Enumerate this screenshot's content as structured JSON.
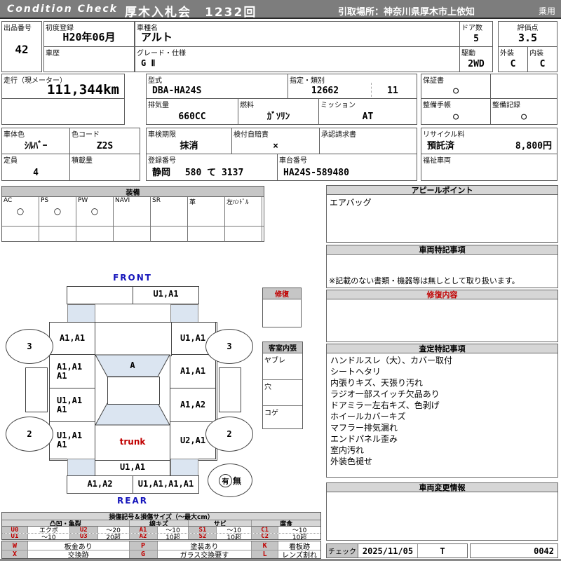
{
  "header": {
    "brand": "Condition  Check",
    "title": "厚木入札会　1232回",
    "pickup": "引取場所：神奈川県厚木市上依知",
    "category": "乗用"
  },
  "info": {
    "lot_label": "出品番号",
    "lot_value": "42",
    "first_reg_label": "初度登録",
    "first_reg_value": "H20年06月",
    "history_label": "車歴",
    "history_value": "",
    "model_label": "車種名",
    "model_value": "アルト",
    "grade_label": "グレード・仕様",
    "grade_value": "G Ⅱ",
    "doors_label": "ドア数",
    "doors_value": "5",
    "drive_label": "駆動",
    "drive_value": "2WD",
    "score_label": "評価点",
    "score_value": "3.5",
    "exterior_label": "外装",
    "exterior_value": "C",
    "interior_label": "内装",
    "interior_value": "C",
    "mileage_label": "走行（現メーター）",
    "mileage_value": "111,344km",
    "type_label": "型式",
    "type_value": "DBA-HA24S",
    "class_label": "指定・類別",
    "class_value1": "12662",
    "class_value2": "11",
    "displacement_label": "排気量",
    "displacement_value": "660CC",
    "fuel_label": "燃料",
    "fuel_value": "ｶﾞｿﾘﾝ",
    "transmission_label": "ミッション",
    "transmission_value": "AT",
    "warranty_label": "保証書",
    "warranty_value": "○",
    "maintenance_book_label": "整備手帳",
    "maintenance_book_value": "○",
    "maintenance_record_label": "整備記録",
    "maintenance_record_value": "○",
    "body_color_label": "車体色",
    "body_color_value": "ｼﾙﾊﾞｰ",
    "color_code_label": "色コード",
    "color_code_value": "Z2S",
    "inspection_label": "車検期限",
    "inspection_value": "抹消",
    "insurance_label": "検付自賠責",
    "insurance_value": "×",
    "approval_label": "承認請求書",
    "approval_value": "",
    "capacity_label": "定員",
    "capacity_value": "4",
    "load_label": "積載量",
    "load_value": "",
    "plate_label": "登録番号",
    "plate_value": "静岡　 580 て  3137",
    "chassis_label": "車台番号",
    "chassis_value": "HA24S-589480",
    "recycle_label": "リサイクル料",
    "recycle_status": "預託済",
    "recycle_fee": "8,800円",
    "welfare_label": "福祉車両",
    "welfare_value": ""
  },
  "equipment": {
    "title": "装備",
    "items": [
      {
        "label": "AC",
        "value": "○"
      },
      {
        "label": "PS",
        "value": "○"
      },
      {
        "label": "PW",
        "value": "○"
      },
      {
        "label": "NAVI",
        "value": ""
      },
      {
        "label": "SR",
        "value": ""
      },
      {
        "label": "革",
        "value": ""
      },
      {
        "label": "左ﾊﾝﾄﾞﾙ",
        "value": ""
      }
    ]
  },
  "diagram": {
    "front": "FRONT",
    "rear": "REAR",
    "front_bumper": "U1,A1",
    "lf_fender": "A1,A1",
    "rf_fender": "U1,A1",
    "lf_door": "A1,A1\nA1",
    "rf_door": "A1,A1",
    "lr_door": "U1,A1\nA1",
    "rr_door": "A1,A2",
    "lr_quarter": "U1,A1\nA1",
    "rr_quarter": "U2,A1",
    "windshield": "A",
    "trunk": "trunk",
    "rear_panel": "U1,A1",
    "rear_bumper_left": "A1,A2",
    "rear_bumper_right": "U1,A1,A1,A1",
    "front_wheel_left": "3",
    "front_wheel_right": "3",
    "rear_wheel_left": "2",
    "rear_wheel_right": "2",
    "presence_yes": "有",
    "presence_no": "無",
    "repair_title": "修復",
    "cabin_title": "客室内張",
    "cabin_rows": [
      "ヤブレ",
      "穴",
      "コゲ"
    ]
  },
  "sections": {
    "appeal": {
      "title": "アピールポイント",
      "content": "エアバッグ"
    },
    "vehicle_notes": {
      "title": "車両特記事項",
      "note": "※記載のない書類・機器等は無しとして取り扱います。"
    },
    "repair_detail": {
      "title": "修復内容",
      "content": ""
    },
    "assessment": {
      "title": "査定特記事項",
      "lines": [
        "ハンドルスレ（大）、カバー取付",
        "シートヘタリ",
        "内張りキズ、天張り汚れ",
        "ラジオ一部スイッチ欠品あり",
        "ドアミラー左右キズ、色剥げ",
        "ホイールカバーキズ",
        "マフラー排気漏れ",
        "エンドパネル歪み",
        "室内汚れ",
        "外装色褪せ"
      ]
    },
    "change_info": {
      "title": "車両変更情報",
      "content": ""
    },
    "check": {
      "label": "チェック",
      "date": "2025/11/05",
      "inspector": "T",
      "number": "0042"
    }
  },
  "legend": {
    "title": "損傷記号＆損傷サイズ（～最大cm）",
    "groups": [
      "凸凹・亀裂",
      "線キズ",
      "サビ",
      "腐食"
    ],
    "row1": [
      "U0",
      "エクボ",
      "U2",
      "～20",
      "A1",
      "～10",
      "S1",
      "～10",
      "C1",
      "～10"
    ],
    "row2": [
      "U1",
      "～10",
      "U3",
      "20超",
      "A2",
      "10超",
      "S2",
      "10超",
      "C2",
      "10超"
    ],
    "marks_row1": [
      "W",
      "板金あり",
      "P",
      "塗装あり",
      "K",
      "看板跡"
    ],
    "marks_row2": [
      "X",
      "交換跡",
      "G",
      "ガラス交換要す",
      "L",
      "レンズ割れ"
    ]
  },
  "colors": {
    "accent_red": "#c00000",
    "label_blue": "#1515bb",
    "shade_blue": "#dbe5f1",
    "titlebar_gray": "#7d7d7d"
  }
}
